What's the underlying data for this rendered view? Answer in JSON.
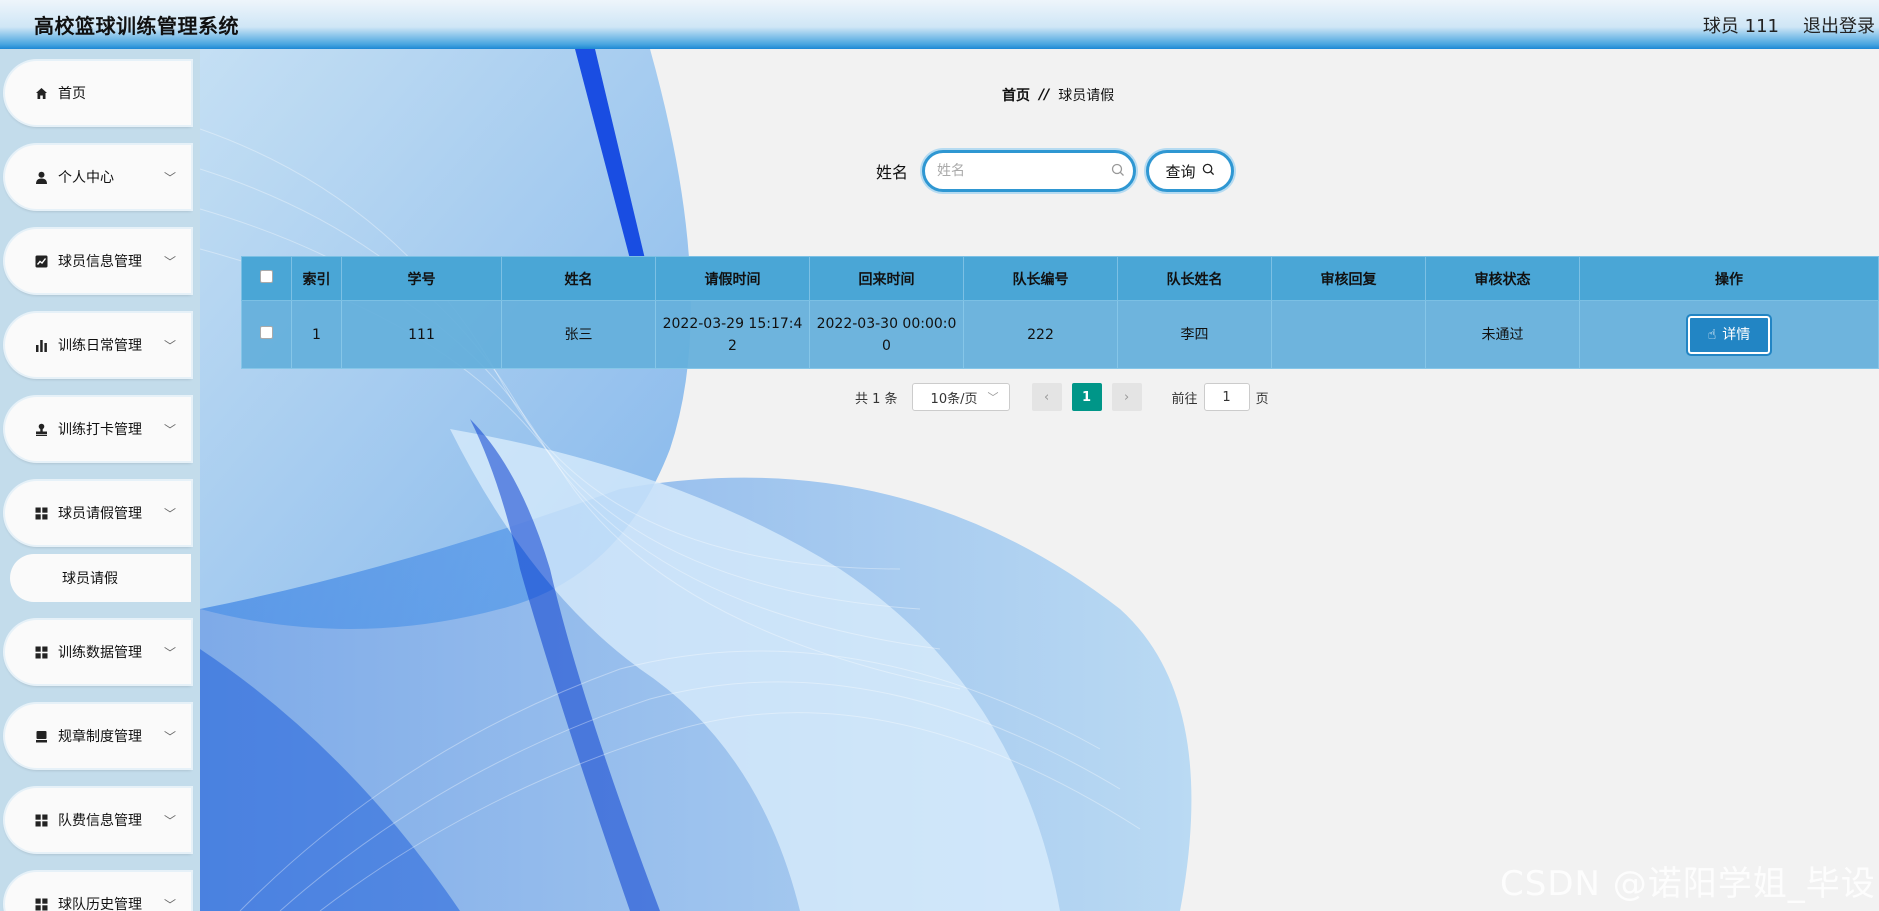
{
  "header": {
    "title": "高校篮球训练管理系统",
    "user": "球员 111",
    "logout": "退出登录"
  },
  "sidebar": {
    "items": [
      {
        "label": "首页",
        "icon": "home-icon"
      },
      {
        "label": "个人中心",
        "icon": "user-icon"
      },
      {
        "label": "球员信息管理",
        "icon": "trend-chart-icon"
      },
      {
        "label": "训练日常管理",
        "icon": "bar-chart-icon"
      },
      {
        "label": "训练打卡管理",
        "icon": "stamp-icon"
      },
      {
        "label": "球员请假管理",
        "icon": "grid-icon"
      },
      {
        "label": "训练数据管理",
        "icon": "grid-icon"
      },
      {
        "label": "规章制度管理",
        "icon": "document-icon"
      },
      {
        "label": "队费信息管理",
        "icon": "grid-icon"
      },
      {
        "label": "球队历史管理",
        "icon": "grid-icon"
      }
    ],
    "submenu": {
      "label": "球员请假"
    }
  },
  "breadcrumb": {
    "home": "首页",
    "sep": "//",
    "current": "球员请假"
  },
  "search": {
    "label": "姓名",
    "placeholder": "姓名",
    "button": "查询"
  },
  "table": {
    "columns": [
      "索引",
      "学号",
      "姓名",
      "请假时间",
      "回来时间",
      "队长编号",
      "队长姓名",
      "审核回复",
      "审核状态",
      "操作"
    ],
    "rows": [
      {
        "index": "1",
        "student_id": "111",
        "name": "张三",
        "leave_time_1": "2022-03-29 15:17:4",
        "leave_time_2": "2",
        "return_time_1": "2022-03-30 00:00:0",
        "return_time_2": "0",
        "captain_id": "222",
        "captain_name": "李四",
        "review_reply": "",
        "review_status": "未通过",
        "action": "详情"
      }
    ]
  },
  "pager": {
    "total": "共 1 条",
    "page_size": "10条/页",
    "current_page": "1",
    "goto_label": "前往",
    "goto_value": "1",
    "page_suffix": "页"
  },
  "watermark": "CSDN @诺阳学姐_毕设",
  "colors": {
    "accent": "#2f97d2",
    "table_header": "#4aa6d6",
    "pager_active": "#009688"
  }
}
